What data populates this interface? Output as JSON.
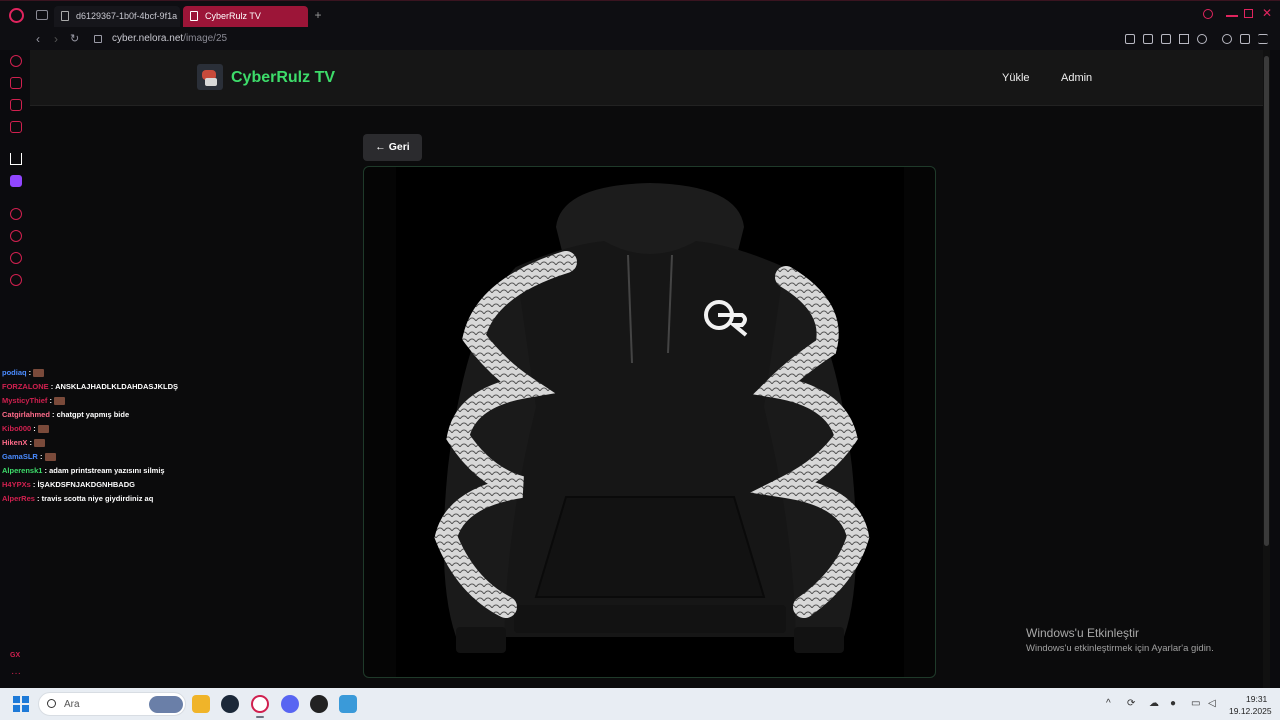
{
  "browser": {
    "tabs": [
      {
        "label": "d6129367-1b0f-4bcf-9f1a"
      },
      {
        "label": "CyberRulz TV"
      }
    ],
    "url_host": "cyber.nelora.net",
    "url_path": "/image/25"
  },
  "site": {
    "title": "CyberRulz TV",
    "nav": {
      "upload": "Yükle",
      "admin": "Admin"
    },
    "back_label": "← Geri",
    "title_color": "#3ddc6a"
  },
  "chat": [
    {
      "user": "podiaq",
      "color": "#4a8bff",
      "msg": ""
    },
    {
      "user": "FORZALONE",
      "color": "#d0204f",
      "msg": "ANSKLAJHADLKLDAHDASJKLDŞ"
    },
    {
      "user": "MysticyThief",
      "color": "#d0204f",
      "msg": ""
    },
    {
      "user": "Catgirlahmed",
      "color": "#ff6b8a",
      "msg": "chatgpt yapmış bide"
    },
    {
      "user": "Kibo000",
      "color": "#d0204f",
      "msg": ""
    },
    {
      "user": "HikenX",
      "color": "#ff6b8a",
      "msg": ""
    },
    {
      "user": "GamaSLR",
      "color": "#4a8bff",
      "msg": ""
    },
    {
      "user": "Alperensk1",
      "color": "#3ddc6a",
      "msg": "adam printstream yazısını silmiş"
    },
    {
      "user": "H4YPXs",
      "color": "#d0204f",
      "msg": "İŞAKDSFNJAKDGNHBADG"
    },
    {
      "user": "AlperRes",
      "color": "#d0204f",
      "msg": "travis scotta niye giydirdiniz aq"
    }
  ],
  "watermark": {
    "line1": "Windows'u Etkinleştir",
    "line2": "Windows'u etkinleştirmek için Ayarlar'a gidin."
  },
  "taskbar": {
    "search_placeholder": "Ara",
    "time": "19:31",
    "date": "19.12.2025"
  }
}
